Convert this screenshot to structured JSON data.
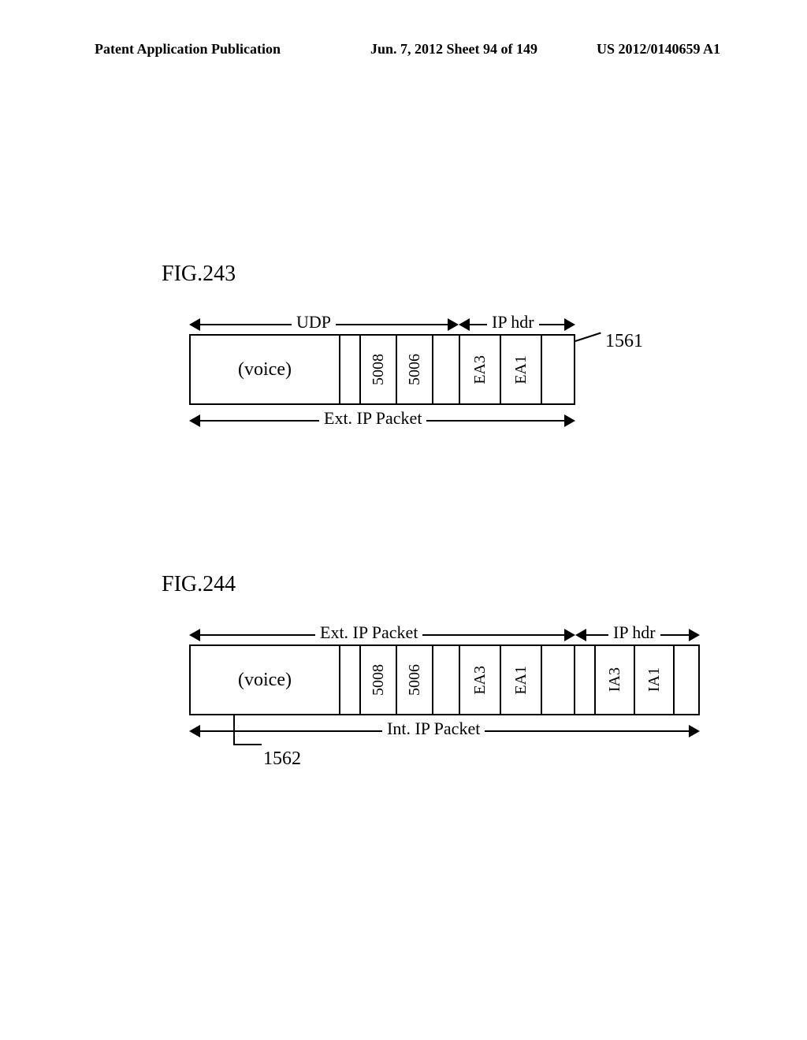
{
  "header": {
    "left": "Patent Application Publication",
    "mid": "Jun. 7, 2012  Sheet 94 of 149",
    "right": "US 2012/0140659 A1"
  },
  "fig243": {
    "label": "FIG.243",
    "dim_udp": "UDP",
    "dim_iphdr": "IP hdr",
    "dim_ext": "Ext. IP Packet",
    "ref": "1561",
    "cells": {
      "voice": "(voice)",
      "p5008": "5008",
      "p5006": "5006",
      "ea3": "EA3",
      "ea1": "EA1"
    }
  },
  "fig244": {
    "label": "FIG.244",
    "dim_ext": "Ext. IP Packet",
    "dim_iphdr": "IP hdr",
    "dim_int": "Int. IP Packet",
    "ref": "1562",
    "cells": {
      "voice": "(voice)",
      "p5008": "5008",
      "p5006": "5006",
      "ea3": "EA3",
      "ea1": "EA1",
      "ia3": "IA3",
      "ia1": "IA1"
    }
  }
}
